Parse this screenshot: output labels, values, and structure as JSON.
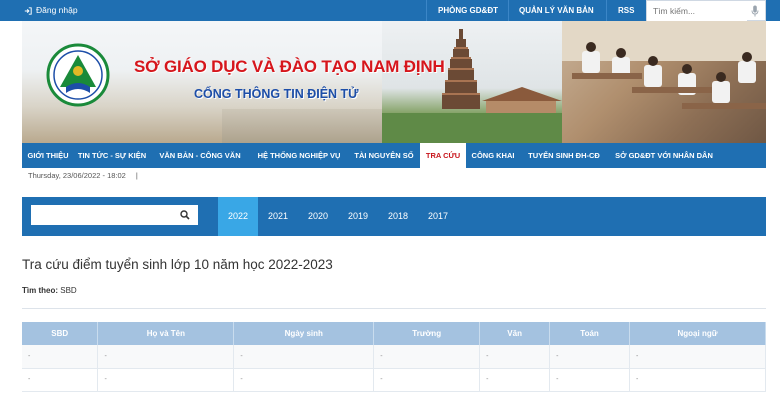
{
  "topbar": {
    "login_label": "Đăng nhập",
    "links": [
      "PHÒNG GD&ĐT",
      "QUẢN LÝ VĂN BẢN",
      "RSS"
    ],
    "search_placeholder": "Tìm kiếm..."
  },
  "banner": {
    "title": "SỞ GIÁO DỤC VÀ ĐÀO TẠO NAM ĐỊNH",
    "subtitle": "CỔNG THÔNG TIN ĐIỆN TỬ"
  },
  "nav": {
    "items": [
      "GIỚI THIỆU",
      "TIN TỨC - SỰ KIỆN",
      "VĂN BẢN - CÔNG VĂN",
      "HỆ THỐNG NGHIỆP VỤ",
      "TÀI NGUYÊN SỐ",
      "TRA CỨU",
      "CÔNG KHAI",
      "TUYỂN SINH ĐH-CĐ",
      "SỞ GD&ĐT VỚI NHÂN DÂN"
    ],
    "active": "TRA CỨU"
  },
  "dateline": {
    "date": "Thursday, 23/06/2022 - 18:02",
    "bar": "|"
  },
  "search_panel": {
    "input_value": "",
    "years": [
      "2022",
      "2021",
      "2020",
      "2019",
      "2018",
      "2017"
    ],
    "active_year": "2022"
  },
  "page": {
    "heading": "Tra cứu điểm tuyển sinh lớp 10 năm học 2022-2023",
    "filter_label": "Tìm theo:",
    "filter_value": "SBD"
  },
  "table": {
    "columns": [
      "SBD",
      "Họ và Tên",
      "Ngày sinh",
      "Trường",
      "Văn",
      "Toán",
      "Ngoại ngữ"
    ],
    "rows": [
      [
        "-",
        "-",
        "-",
        "-",
        "-",
        "-",
        "-"
      ],
      [
        "-",
        "-",
        "-",
        "-",
        "-",
        "-",
        "-"
      ]
    ]
  },
  "colors": {
    "primary": "#1f6fb2",
    "accent_year": "#39a7e6",
    "title_red": "#d6161c",
    "header_blue": "#a4c2e0"
  }
}
